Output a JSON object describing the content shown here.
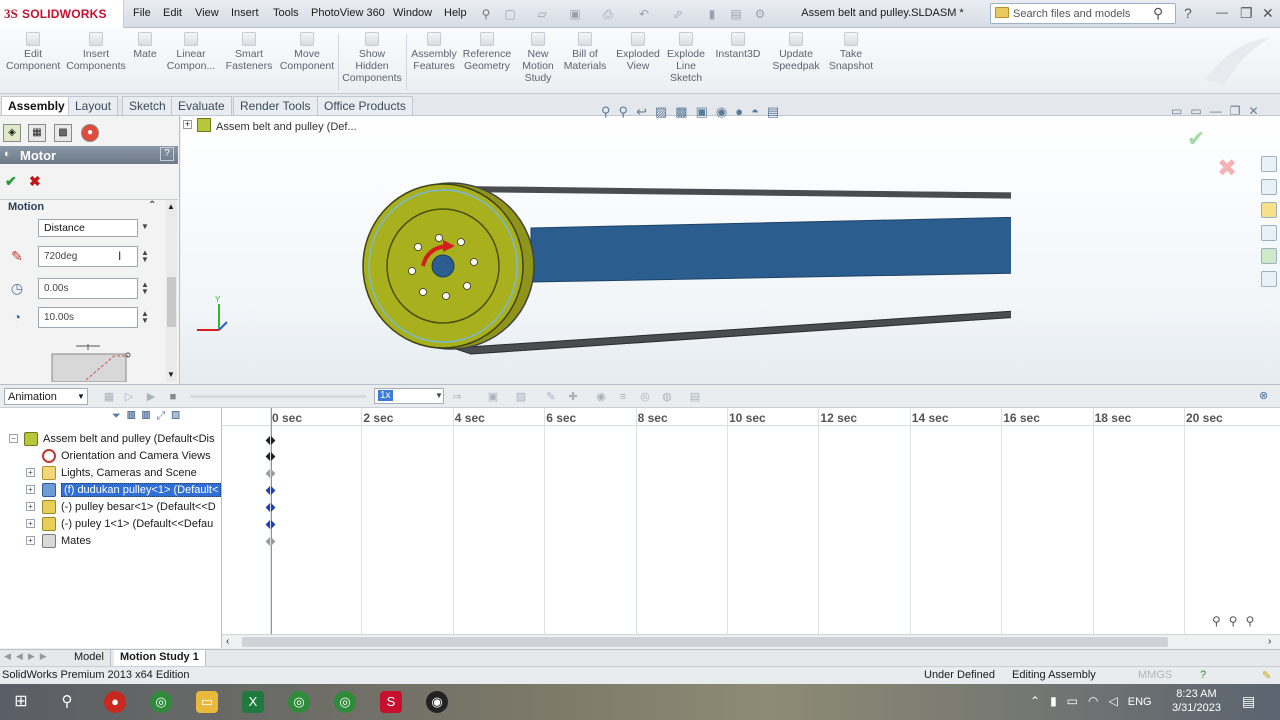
{
  "app": {
    "brand": "SOLIDWORKS",
    "doc_title": "Assem belt and pulley.SLDASM *"
  },
  "menu": [
    "File",
    "Edit",
    "View",
    "Insert",
    "Tools",
    "PhotoView 360",
    "Window",
    "Help"
  ],
  "search": {
    "placeholder": "Search files and models"
  },
  "commands": [
    {
      "label": "Edit\nComponent",
      "icon": "edit-component-icon"
    },
    {
      "label": "Insert\nComponents",
      "icon": "insert-components-icon"
    },
    {
      "label": "Mate",
      "icon": "mate-icon"
    },
    {
      "label": "Linear\nCompon...",
      "icon": "linear-pattern-icon"
    },
    {
      "label": "Smart\nFasteners",
      "icon": "smart-fasteners-icon"
    },
    {
      "label": "Move\nComponent",
      "icon": "move-component-icon"
    },
    {
      "label": "Show\nHidden\nComponents",
      "icon": "show-hidden-icon"
    },
    {
      "label": "Assembly\nFeatures",
      "icon": "assembly-features-icon"
    },
    {
      "label": "Reference\nGeometry",
      "icon": "reference-geometry-icon"
    },
    {
      "label": "New\nMotion\nStudy",
      "icon": "new-motion-study-icon"
    },
    {
      "label": "Bill of\nMaterials",
      "icon": "bom-icon"
    },
    {
      "label": "Exploded\nView",
      "icon": "exploded-view-icon"
    },
    {
      "label": "Explode\nLine\nSketch",
      "icon": "explode-line-icon"
    },
    {
      "label": "Instant3D",
      "icon": "instant3d-icon"
    },
    {
      "label": "Update\nSpeedpak",
      "icon": "speedpak-icon"
    },
    {
      "label": "Take\nSnapshot",
      "icon": "snapshot-icon"
    }
  ],
  "tabs": [
    "Assembly",
    "Layout",
    "Sketch",
    "Evaluate",
    "Render Tools",
    "Office Products"
  ],
  "property_manager": {
    "title": "Motor",
    "help": "?",
    "section": "Motion",
    "motion_type": "Distance",
    "distance": "720deg",
    "start_time": "0.00s",
    "duration": "10.00s"
  },
  "viewport": {
    "tree_label": "Assem belt and pulley  (Def..."
  },
  "motion_study": {
    "type": "Animation",
    "speed": "1x",
    "ticks": [
      "0 sec",
      "2 sec",
      "4 sec",
      "6 sec",
      "8 sec",
      "10 sec",
      "12 sec",
      "14 sec",
      "16 sec",
      "18 sec",
      "20 sec"
    ],
    "tree": [
      {
        "label": "Assem belt and pulley  (Default<Dis",
        "selected": false
      },
      {
        "label": "Orientation and Camera Views",
        "selected": false
      },
      {
        "label": "Lights, Cameras and Scene",
        "selected": false
      },
      {
        "label": "(f) dudukan pulley<1> (Default<",
        "selected": true
      },
      {
        "label": "(-) pulley besar<1> (Default<<D",
        "selected": false
      },
      {
        "label": "(-) puley 1<1> (Default<<Defau",
        "selected": false
      },
      {
        "label": "Mates",
        "selected": false
      }
    ]
  },
  "bottom_tabs": [
    "Model",
    "Motion Study 1"
  ],
  "status": {
    "edition": "SolidWorks Premium 2013 x64 Edition",
    "state": "Under Defined",
    "mode": "Editing Assembly",
    "units": "MMGS"
  },
  "taskbar": {
    "lang": "ENG",
    "time": "8:23 AM",
    "date": "3/31/2023"
  },
  "colors": {
    "pulley": "#a8b01e",
    "belt_inner": "#2b5d8e",
    "belt": "#3d3f42",
    "selection": "#2f6fd6"
  }
}
